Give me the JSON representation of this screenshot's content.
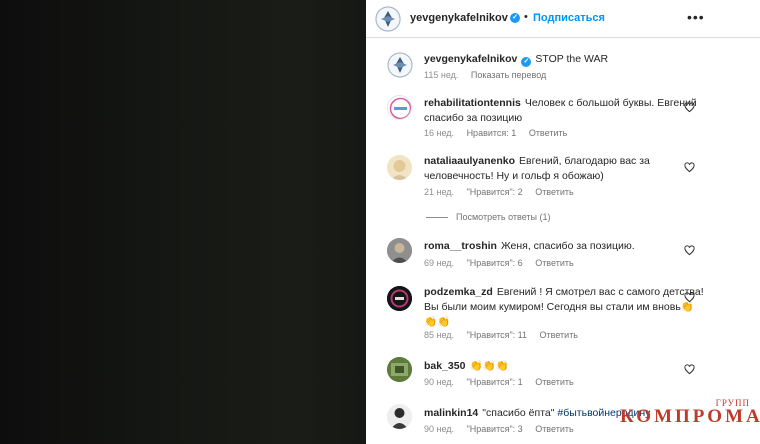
{
  "header": {
    "username": "yevgenykafelnikov",
    "dot": "•",
    "subscribe_label": "Подписаться",
    "more_label": "•••"
  },
  "caption": {
    "username": "yevgenykafelnikov",
    "text": "STOP the WAR",
    "time": "115 нед.",
    "translate": "Показать перевод"
  },
  "comments": [
    {
      "username": "rehabilitationtennis",
      "text": "Человек с большой буквы. Евгений спасибо за позицию",
      "time": "16 нед.",
      "likes": "Нравится: 1",
      "reply": "Ответить"
    },
    {
      "username": "nataliaaulyanenko",
      "text": "Евгений, благодарю вас за человечность! Ну и гольф я обожаю)",
      "time": "21 нед.",
      "likes": "\"Нравится\": 2",
      "reply": "Ответить",
      "view_replies": "Посмотреть ответы (1)"
    },
    {
      "username": "roma__troshin",
      "text": "Женя, спасибо за позицию.",
      "time": "69 нед.",
      "likes": "\"Нравится\": 6",
      "reply": "Ответить"
    },
    {
      "username": "podzemka_zd",
      "text": "Евгений ! Я смотрел вас с самого детства! Вы были моим кумиром! Сегодня вы стали им вновь👏 👏👏",
      "time": "85 нед.",
      "likes": "\"Нравится\": 11",
      "reply": "Ответить"
    },
    {
      "username": "bak_350",
      "text": "👏👏👏",
      "time": "90 нед.",
      "likes": "\"Нравится\": 1",
      "reply": "Ответить"
    },
    {
      "username": "malinkin14",
      "text": "\"спасибо ёпта\"",
      "hashtag": "#бытьвойнеродину",
      "time": "90 нед.",
      "likes": "\"Нравится\": 3",
      "reply": "Ответить"
    }
  ],
  "watermark": {
    "small": "ГРУПП",
    "big": "КОМПРОМАТ"
  },
  "colors": {
    "accent": "#0095f6",
    "verified": "#1d9bf0",
    "media_bg": "#141613",
    "watermark": "#c0392b"
  }
}
